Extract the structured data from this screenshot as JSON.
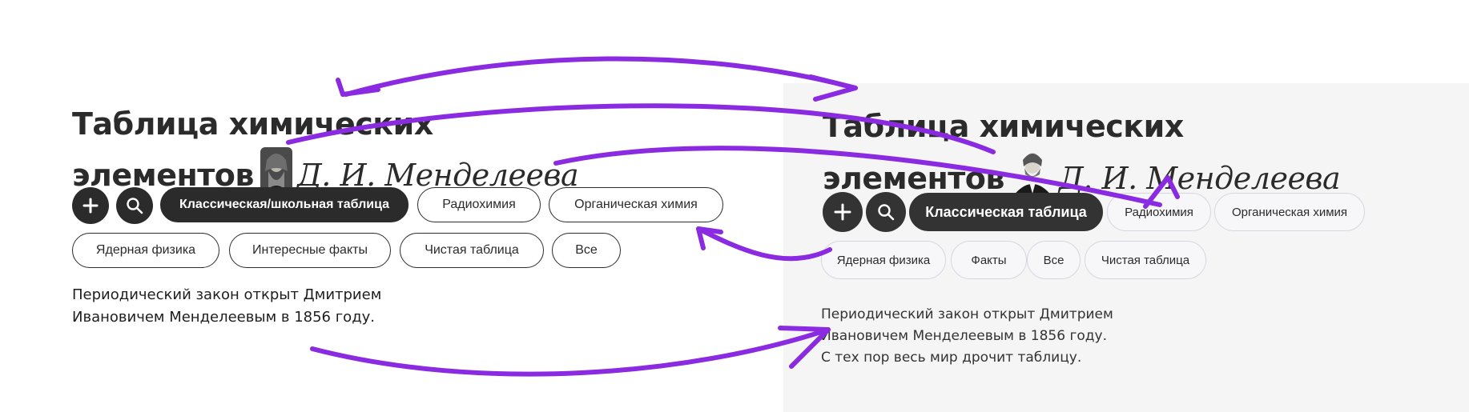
{
  "left": {
    "title_line1": "Таблица химических",
    "title_line2": "элементов",
    "author": "Д. И. Менделеева",
    "add_label": "+",
    "tabs": [
      "Классическая/школьная таблица",
      "Радиохимия",
      "Органическая химия",
      "Ядерная физика",
      "Интересные факты",
      "Чистая таблица",
      "Все"
    ],
    "para_line1": "Периодический закон открыт Дмитрием",
    "para_line2": "Ивановичем Менделеевым в 1856 году."
  },
  "right": {
    "title_line1": "Таблица химических",
    "title_line2": "элементов",
    "author": "Д. И. Менделеева",
    "add_label": "+",
    "tabs": [
      "Классическая таблица",
      "Радиохимия",
      "Органическая химия",
      "Ядерная физика",
      "Факты",
      "Все",
      "Чистая таблица"
    ],
    "para_line1": "Периодический закон открыт Дмитрием",
    "para_line2": "Ивановичем Менделеевым в 1856 году.",
    "para_line3": "С тех пор весь мир дрочит таблицу."
  },
  "colors": {
    "accent": "#8a2be2",
    "dark_button": "#2b2b2b",
    "panel_background": "#f5f5f5"
  },
  "icons": {
    "add": "plus-icon",
    "search": "search-icon",
    "portrait": "portrait-icon"
  }
}
